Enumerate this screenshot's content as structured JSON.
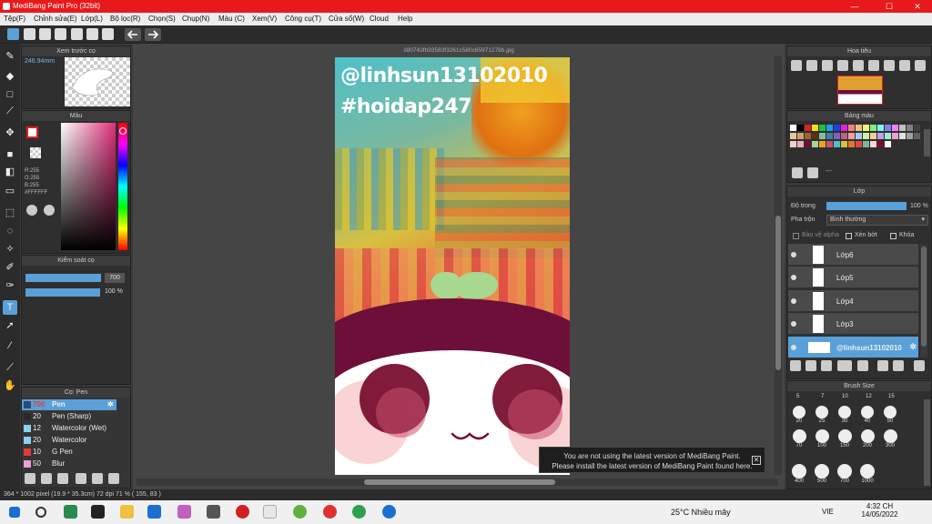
{
  "window": {
    "title": "MediBang Paint Pro (32bit)",
    "minimize": "—",
    "maximize": "☐",
    "close": "✕"
  },
  "menu": [
    "Tệp(F)",
    "Chỉnh sửa(E)",
    "Lớp(L)",
    "Bộ lọc(R)",
    "Chọn(S)",
    "Chụp(N)",
    "Màu (C)",
    "Xem(V)",
    "Công cụ(T)",
    "Cửa sổ(W)",
    "Cloud",
    "Help"
  ],
  "panels": {
    "preview": {
      "title": "Xem trước cọ",
      "size": "246.94mm"
    },
    "color": {
      "title": "Màu",
      "r": "R:255",
      "g": "G:255",
      "b": "B:255",
      "hex": "#FFFFFF"
    },
    "brushcontrol": {
      "title": "Kiểm soát cọ",
      "size": "700",
      "opacity": "100 %"
    },
    "brushes": {
      "title": "Cọ: Pen",
      "items": [
        {
          "size": "700",
          "name": "Pen",
          "color": "#2a4b7a"
        },
        {
          "size": "20",
          "name": "Pen (Sharp)",
          "color": "#2a2a2a"
        },
        {
          "size": "12",
          "name": "Watercolor (Wet)",
          "color": "#8ad0f0"
        },
        {
          "size": "20",
          "name": "Watercolor",
          "color": "#8ad0f0"
        },
        {
          "size": "10",
          "name": "G Pen",
          "color": "#e03a3a"
        },
        {
          "size": "50",
          "name": "Blur",
          "color": "#f0a0d0"
        }
      ]
    },
    "navigator": {
      "title": "Hoa tiêu"
    },
    "palette": {
      "title": "Bảng màu",
      "extra": "---"
    },
    "layers": {
      "title": "Lớp",
      "opacity_label": "Độ trong",
      "opacity_value": "100 %",
      "blend_label": "Pha trộn",
      "blend_value": "Bình thường",
      "protect_alpha": "Bảo vệ alpha",
      "clipping": "Xén bớt",
      "lock": "Khóa",
      "items": [
        "Lớp6",
        "Lớp5",
        "Lớp4",
        "Lớp3",
        "@linhsun13102010"
      ]
    },
    "brushsize": {
      "title": "Brush Size",
      "top": [
        "5",
        "7",
        "10",
        "12",
        "15"
      ],
      "rows": [
        [
          "20",
          "25",
          "30",
          "40",
          "50"
        ],
        [
          "70",
          "100",
          "150",
          "200",
          "300"
        ],
        [
          "400",
          "500",
          "700",
          "1000"
        ]
      ]
    }
  },
  "document": {
    "tab": "38074",
    "tabtail": "3fb93583f3261c580c65971278b.jpg",
    "text1": "@linhsun13102010",
    "text2": "#hoidap247"
  },
  "status": {
    "text": "364 * 1002 pixel   (19.9 * 35.3cm)   72 dpi   71 %   ( 155, 83 )"
  },
  "toast": {
    "line1": "You are not using the latest version of MediBang Paint.",
    "line2": "Please install the latest version of MediBang Paint found here.",
    "close": "✕"
  },
  "taskbar": {
    "weather": "25°C  Nhiều mây",
    "time": "4:32 CH",
    "date": "14/05/2022",
    "lang": "VIE"
  }
}
